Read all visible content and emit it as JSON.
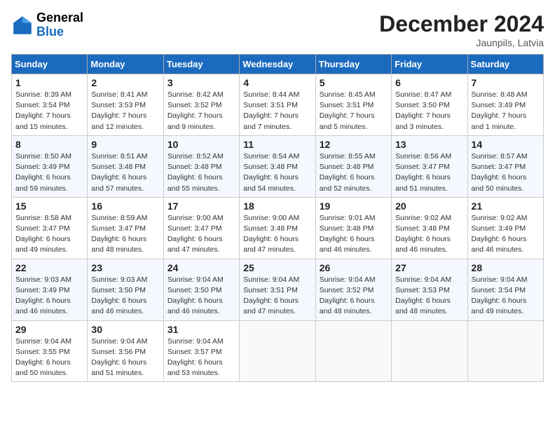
{
  "header": {
    "logo_general": "General",
    "logo_blue": "Blue",
    "month_title": "December 2024",
    "location": "Jaunpils, Latvia"
  },
  "days_of_week": [
    "Sunday",
    "Monday",
    "Tuesday",
    "Wednesday",
    "Thursday",
    "Friday",
    "Saturday"
  ],
  "weeks": [
    [
      {
        "day": 1,
        "sunrise": "Sunrise: 8:39 AM",
        "sunset": "Sunset: 3:54 PM",
        "daylight": "Daylight: 7 hours and 15 minutes."
      },
      {
        "day": 2,
        "sunrise": "Sunrise: 8:41 AM",
        "sunset": "Sunset: 3:53 PM",
        "daylight": "Daylight: 7 hours and 12 minutes."
      },
      {
        "day": 3,
        "sunrise": "Sunrise: 8:42 AM",
        "sunset": "Sunset: 3:52 PM",
        "daylight": "Daylight: 7 hours and 9 minutes."
      },
      {
        "day": 4,
        "sunrise": "Sunrise: 8:44 AM",
        "sunset": "Sunset: 3:51 PM",
        "daylight": "Daylight: 7 hours and 7 minutes."
      },
      {
        "day": 5,
        "sunrise": "Sunrise: 8:45 AM",
        "sunset": "Sunset: 3:51 PM",
        "daylight": "Daylight: 7 hours and 5 minutes."
      },
      {
        "day": 6,
        "sunrise": "Sunrise: 8:47 AM",
        "sunset": "Sunset: 3:50 PM",
        "daylight": "Daylight: 7 hours and 3 minutes."
      },
      {
        "day": 7,
        "sunrise": "Sunrise: 8:48 AM",
        "sunset": "Sunset: 3:49 PM",
        "daylight": "Daylight: 7 hours and 1 minute."
      }
    ],
    [
      {
        "day": 8,
        "sunrise": "Sunrise: 8:50 AM",
        "sunset": "Sunset: 3:49 PM",
        "daylight": "Daylight: 6 hours and 59 minutes."
      },
      {
        "day": 9,
        "sunrise": "Sunrise: 8:51 AM",
        "sunset": "Sunset: 3:48 PM",
        "daylight": "Daylight: 6 hours and 57 minutes."
      },
      {
        "day": 10,
        "sunrise": "Sunrise: 8:52 AM",
        "sunset": "Sunset: 3:48 PM",
        "daylight": "Daylight: 6 hours and 55 minutes."
      },
      {
        "day": 11,
        "sunrise": "Sunrise: 8:54 AM",
        "sunset": "Sunset: 3:48 PM",
        "daylight": "Daylight: 6 hours and 54 minutes."
      },
      {
        "day": 12,
        "sunrise": "Sunrise: 8:55 AM",
        "sunset": "Sunset: 3:48 PM",
        "daylight": "Daylight: 6 hours and 52 minutes."
      },
      {
        "day": 13,
        "sunrise": "Sunrise: 8:56 AM",
        "sunset": "Sunset: 3:47 PM",
        "daylight": "Daylight: 6 hours and 51 minutes."
      },
      {
        "day": 14,
        "sunrise": "Sunrise: 8:57 AM",
        "sunset": "Sunset: 3:47 PM",
        "daylight": "Daylight: 6 hours and 50 minutes."
      }
    ],
    [
      {
        "day": 15,
        "sunrise": "Sunrise: 8:58 AM",
        "sunset": "Sunset: 3:47 PM",
        "daylight": "Daylight: 6 hours and 49 minutes."
      },
      {
        "day": 16,
        "sunrise": "Sunrise: 8:59 AM",
        "sunset": "Sunset: 3:47 PM",
        "daylight": "Daylight: 6 hours and 48 minutes."
      },
      {
        "day": 17,
        "sunrise": "Sunrise: 9:00 AM",
        "sunset": "Sunset: 3:47 PM",
        "daylight": "Daylight: 6 hours and 47 minutes."
      },
      {
        "day": 18,
        "sunrise": "Sunrise: 9:00 AM",
        "sunset": "Sunset: 3:48 PM",
        "daylight": "Daylight: 6 hours and 47 minutes."
      },
      {
        "day": 19,
        "sunrise": "Sunrise: 9:01 AM",
        "sunset": "Sunset: 3:48 PM",
        "daylight": "Daylight: 6 hours and 46 minutes."
      },
      {
        "day": 20,
        "sunrise": "Sunrise: 9:02 AM",
        "sunset": "Sunset: 3:48 PM",
        "daylight": "Daylight: 6 hours and 46 minutes."
      },
      {
        "day": 21,
        "sunrise": "Sunrise: 9:02 AM",
        "sunset": "Sunset: 3:49 PM",
        "daylight": "Daylight: 6 hours and 46 minutes."
      }
    ],
    [
      {
        "day": 22,
        "sunrise": "Sunrise: 9:03 AM",
        "sunset": "Sunset: 3:49 PM",
        "daylight": "Daylight: 6 hours and 46 minutes."
      },
      {
        "day": 23,
        "sunrise": "Sunrise: 9:03 AM",
        "sunset": "Sunset: 3:50 PM",
        "daylight": "Daylight: 6 hours and 46 minutes."
      },
      {
        "day": 24,
        "sunrise": "Sunrise: 9:04 AM",
        "sunset": "Sunset: 3:50 PM",
        "daylight": "Daylight: 6 hours and 46 minutes."
      },
      {
        "day": 25,
        "sunrise": "Sunrise: 9:04 AM",
        "sunset": "Sunset: 3:51 PM",
        "daylight": "Daylight: 6 hours and 47 minutes."
      },
      {
        "day": 26,
        "sunrise": "Sunrise: 9:04 AM",
        "sunset": "Sunset: 3:52 PM",
        "daylight": "Daylight: 6 hours and 48 minutes."
      },
      {
        "day": 27,
        "sunrise": "Sunrise: 9:04 AM",
        "sunset": "Sunset: 3:53 PM",
        "daylight": "Daylight: 6 hours and 48 minutes."
      },
      {
        "day": 28,
        "sunrise": "Sunrise: 9:04 AM",
        "sunset": "Sunset: 3:54 PM",
        "daylight": "Daylight: 6 hours and 49 minutes."
      }
    ],
    [
      {
        "day": 29,
        "sunrise": "Sunrise: 9:04 AM",
        "sunset": "Sunset: 3:55 PM",
        "daylight": "Daylight: 6 hours and 50 minutes."
      },
      {
        "day": 30,
        "sunrise": "Sunrise: 9:04 AM",
        "sunset": "Sunset: 3:56 PM",
        "daylight": "Daylight: 6 hours and 51 minutes."
      },
      {
        "day": 31,
        "sunrise": "Sunrise: 9:04 AM",
        "sunset": "Sunset: 3:57 PM",
        "daylight": "Daylight: 6 hours and 53 minutes."
      },
      null,
      null,
      null,
      null
    ]
  ]
}
